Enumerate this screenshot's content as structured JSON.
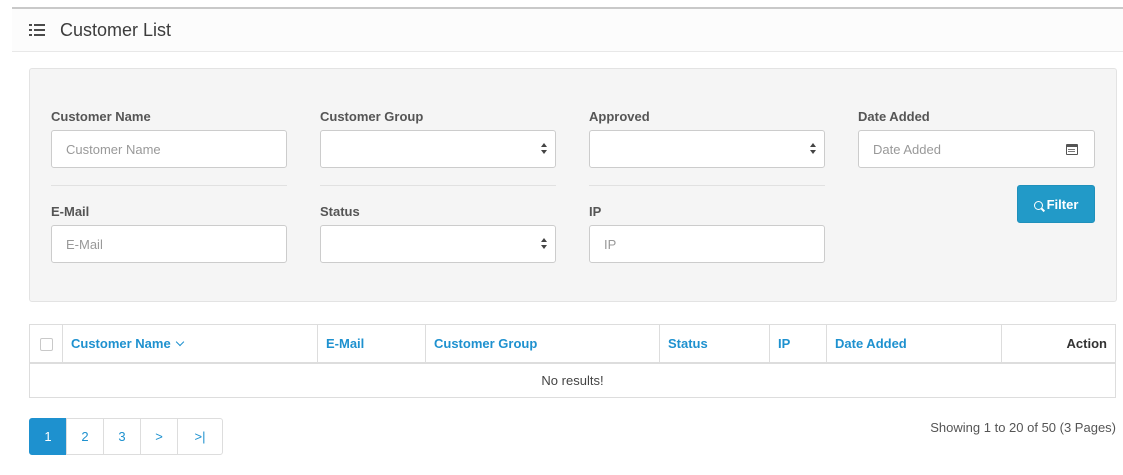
{
  "panel": {
    "title": "Customer List",
    "icon": "list-icon"
  },
  "filters": {
    "customer_name": {
      "label": "Customer Name",
      "placeholder": "Customer Name",
      "value": ""
    },
    "customer_group": {
      "label": "Customer Group",
      "value": ""
    },
    "approved": {
      "label": "Approved",
      "value": ""
    },
    "date_added": {
      "label": "Date Added",
      "placeholder": "Date Added",
      "value": ""
    },
    "email": {
      "label": "E-Mail",
      "placeholder": "E-Mail",
      "value": ""
    },
    "status": {
      "label": "Status",
      "value": ""
    },
    "ip": {
      "label": "IP",
      "placeholder": "IP",
      "value": ""
    },
    "filter_button_label": "Filter"
  },
  "table": {
    "columns": [
      {
        "key": "name",
        "label": "Customer Name",
        "sorted": "desc"
      },
      {
        "key": "email",
        "label": "E-Mail"
      },
      {
        "key": "group",
        "label": "Customer Group"
      },
      {
        "key": "status",
        "label": "Status"
      },
      {
        "key": "ip",
        "label": "IP"
      },
      {
        "key": "date_added",
        "label": "Date Added"
      },
      {
        "key": "action",
        "label": "Action"
      }
    ],
    "empty_message": "No results!"
  },
  "pagination": {
    "pages": [
      "1",
      "2",
      "3",
      ">",
      ">|"
    ],
    "active": "1",
    "summary": "Showing 1 to 20 of 50 (3 Pages)"
  },
  "colors": {
    "accent": "#1e91cf",
    "button": "#229ac8",
    "filter_bg": "#f5f5f5"
  }
}
